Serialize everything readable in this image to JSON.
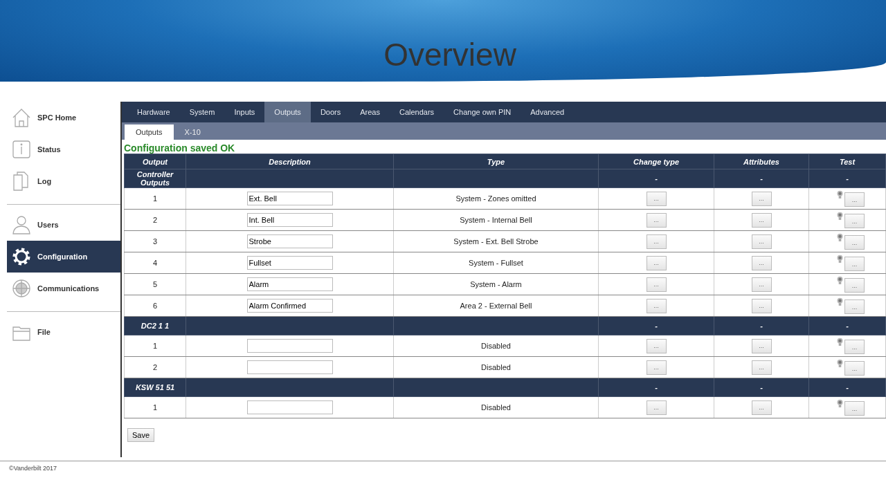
{
  "header": {
    "title": "Overview"
  },
  "sidebar": {
    "sections": [
      [
        {
          "label": "SPC Home",
          "selected": false
        },
        {
          "label": "Status",
          "selected": false
        },
        {
          "label": "Log",
          "selected": false
        }
      ],
      [
        {
          "label": "Users",
          "selected": false
        },
        {
          "label": "Configuration",
          "selected": true
        },
        {
          "label": "Communications",
          "selected": false
        }
      ],
      [
        {
          "label": "File",
          "selected": false
        }
      ]
    ]
  },
  "tabs": [
    {
      "label": "Hardware",
      "selected": false
    },
    {
      "label": "System",
      "selected": false
    },
    {
      "label": "Inputs",
      "selected": false
    },
    {
      "label": "Outputs",
      "selected": true
    },
    {
      "label": "Doors",
      "selected": false
    },
    {
      "label": "Areas",
      "selected": false
    },
    {
      "label": "Calendars",
      "selected": false
    },
    {
      "label": "Change own PIN",
      "selected": false
    },
    {
      "label": "Advanced",
      "selected": false
    }
  ],
  "subtabs": [
    {
      "label": "Outputs",
      "selected": true
    },
    {
      "label": "X-10",
      "selected": false
    }
  ],
  "message": "Configuration saved OK",
  "table": {
    "columns": [
      "Output",
      "Description",
      "Type",
      "Change type",
      "Attributes",
      "Test"
    ],
    "groups": [
      {
        "name": "Controller Outputs",
        "dashes": [
          "-",
          "-",
          "-"
        ],
        "rows": [
          {
            "output": "1",
            "description": "Ext. Bell",
            "type": "System - Zones omitted",
            "buttons": [
              "...",
              "...",
              "..."
            ]
          },
          {
            "output": "2",
            "description": "Int. Bell",
            "type": "System - Internal Bell",
            "buttons": [
              "...",
              "...",
              "..."
            ]
          },
          {
            "output": "3",
            "description": "Strobe",
            "type": "System - Ext. Bell Strobe",
            "buttons": [
              "...",
              "...",
              "..."
            ]
          },
          {
            "output": "4",
            "description": "Fullset",
            "type": "System - Fullset",
            "buttons": [
              "...",
              "...",
              "..."
            ]
          },
          {
            "output": "5",
            "description": "Alarm",
            "type": "System - Alarm",
            "buttons": [
              "...",
              "...",
              "..."
            ]
          },
          {
            "output": "6",
            "description": "Alarm Confirmed",
            "type": "Area 2 - External Bell",
            "buttons": [
              "...",
              "...",
              "..."
            ]
          }
        ]
      },
      {
        "name": "DC2 1 1",
        "dashes": [
          "-",
          "-",
          "-"
        ],
        "rows": [
          {
            "output": "1",
            "description": "",
            "type": "Disabled",
            "buttons": [
              "...",
              "...",
              "..."
            ]
          },
          {
            "output": "2",
            "description": "",
            "type": "Disabled",
            "buttons": [
              "...",
              "...",
              "..."
            ]
          }
        ]
      },
      {
        "name": "KSW 51 51",
        "dashes": [
          "-",
          "-",
          "-"
        ],
        "rows": [
          {
            "output": "1",
            "description": "",
            "type": "Disabled",
            "buttons": [
              "...",
              "...",
              "..."
            ]
          }
        ]
      }
    ]
  },
  "save_button": "Save",
  "footer": "©Vanderbilt 2017"
}
